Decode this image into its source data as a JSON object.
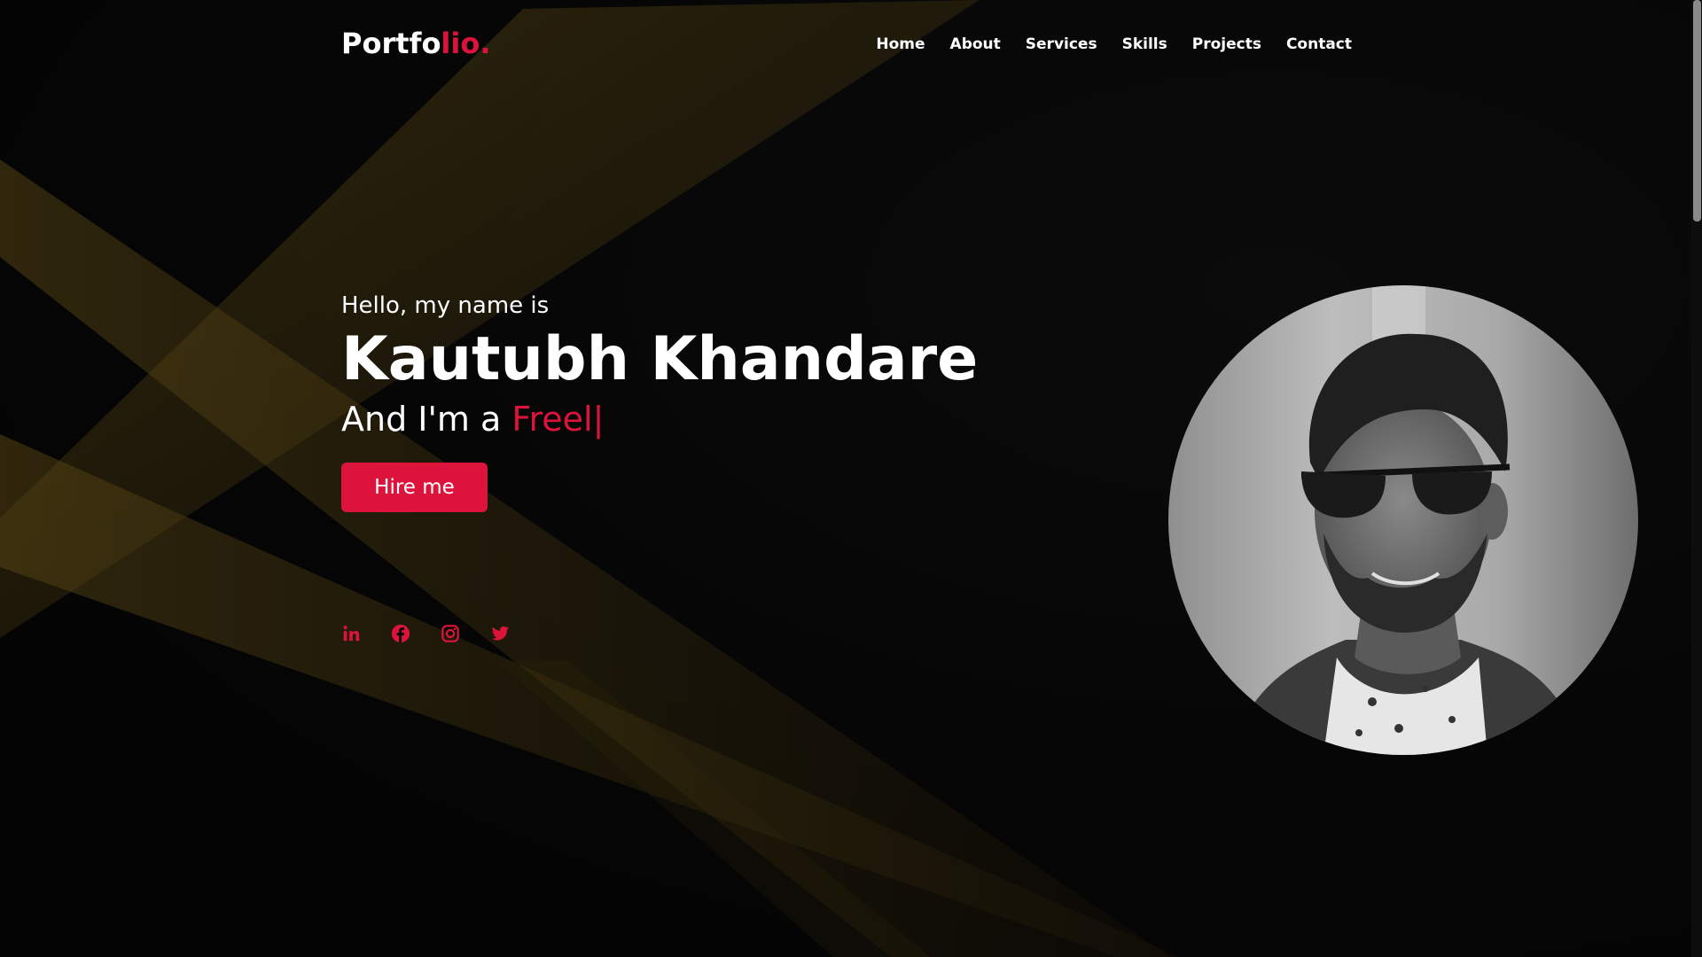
{
  "nav": {
    "logo_main": "Portfo",
    "logo_accent": "lio.",
    "items": [
      {
        "label": "Home"
      },
      {
        "label": "About"
      },
      {
        "label": "Services"
      },
      {
        "label": "Skills"
      },
      {
        "label": "Projects"
      },
      {
        "label": "Contact"
      }
    ]
  },
  "hero": {
    "greeting": "Hello, my name is",
    "name": "Kautubh Khandare",
    "role_prefix": "And I'm a ",
    "role_typed": "Freel",
    "cursor": "|",
    "hire_button": "Hire me"
  },
  "socials": [
    {
      "icon": "linkedin-icon"
    },
    {
      "icon": "facebook-icon"
    },
    {
      "icon": "instagram-icon"
    },
    {
      "icon": "twitter-icon"
    }
  ],
  "colors": {
    "accent": "#dc143c",
    "background": "#050505",
    "beam": "#4a3a12",
    "text": "#ffffff"
  }
}
